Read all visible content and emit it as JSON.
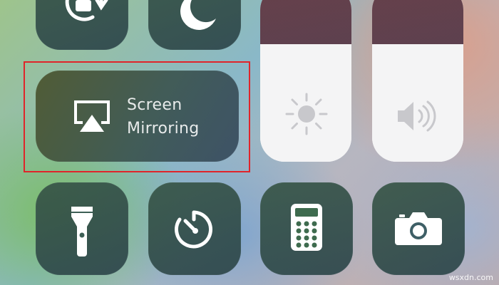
{
  "controls": {
    "screen_mirroring": {
      "label_line1": "Screen",
      "label_line2": "Mirroring",
      "icon": "airplay-icon"
    },
    "orientation_lock": {
      "icon": "orientation-lock-icon"
    },
    "do_not_disturb": {
      "icon": "moon-icon"
    },
    "brightness": {
      "icon": "sun-icon",
      "level": 0.67
    },
    "volume": {
      "icon": "speaker-icon",
      "level": 0.67
    },
    "flashlight": {
      "icon": "flashlight-icon"
    },
    "timer": {
      "icon": "timer-icon"
    },
    "calculator": {
      "icon": "calculator-icon"
    },
    "camera": {
      "icon": "camera-icon"
    }
  },
  "annotation": {
    "highlight_color": "#e0242a"
  },
  "watermark": "wsxdn.com"
}
